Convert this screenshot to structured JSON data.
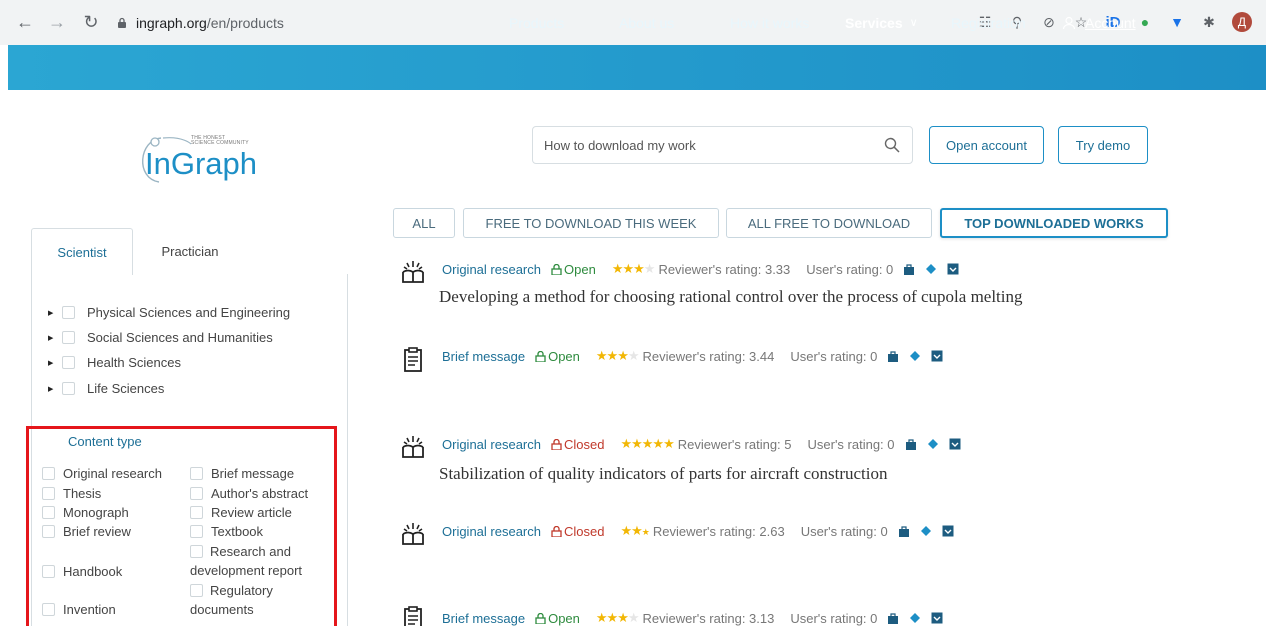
{
  "browser": {
    "url_host": "ingraph.org",
    "url_path": "/en/products",
    "avatar_letter": "Д",
    "id_ext": "iD"
  },
  "site_nav": {
    "items": [
      "Products",
      "About us",
      "How it works",
      "Services",
      "Registration",
      "Account"
    ]
  },
  "logo": {
    "tagline_1": "THE HONEST",
    "tagline_2": "SCIENCE COMMUNITY",
    "word": "InGraph"
  },
  "search": {
    "placeholder": "How to download my work"
  },
  "header_buttons": {
    "open_account": "Open account",
    "try_demo": "Try demo"
  },
  "filter_tabs": [
    "ALL",
    "FREE TO DOWNLOAD THIS WEEK",
    "ALL FREE TO DOWNLOAD",
    "TOP DOWNLOADED WORKS"
  ],
  "filter_active": "TOP DOWNLOADED WORKS",
  "sidebar": {
    "tabs": [
      "Scientist",
      "Practician"
    ],
    "categories": [
      "Physical Sciences and Engineering",
      "Social Sciences and Humanities",
      "Health Sciences",
      "Life Sciences"
    ],
    "content_type_title": "Content type",
    "content_types_left": [
      "Original research",
      "Thesis",
      "Monograph",
      "Brief review",
      "Handbook",
      "Invention"
    ],
    "content_types_right": [
      "Brief message",
      "Author's abstract",
      "Review article",
      "Textbook",
      "Research and development report",
      "Regulatory documents"
    ]
  },
  "works": [
    {
      "type": "Original research",
      "status": "Open",
      "stars": 3,
      "reviewer": "Reviewer's rating: 3.33",
      "user": "User's rating: 0",
      "title": "Developing a method for choosing rational control over the process of cupola melting"
    },
    {
      "type": "Brief message",
      "status": "Open",
      "stars": 3,
      "reviewer": "Reviewer's rating: 3.44",
      "user": "User's rating: 0",
      "title": ""
    },
    {
      "type": "Original research",
      "status": "Closed",
      "stars": 5,
      "reviewer": "Reviewer's rating: 5",
      "user": "User's rating: 0",
      "title": "Stabilization of quality indicators of parts for aircraft construction"
    },
    {
      "type": "Original research",
      "status": "Closed",
      "stars": 2.5,
      "reviewer": "Reviewer's rating: 2.63",
      "user": "User's rating: 0",
      "title": ""
    },
    {
      "type": "Brief message",
      "status": "Open",
      "stars": 3,
      "reviewer": "Reviewer's rating: 3.13",
      "user": "User's rating: 0",
      "title": ""
    }
  ],
  "colors": {
    "brand": "#1d8fc6",
    "highlight": "#e5161b",
    "open": "#2e8b3e",
    "closed": "#c0392b",
    "star": "#f2b705"
  }
}
